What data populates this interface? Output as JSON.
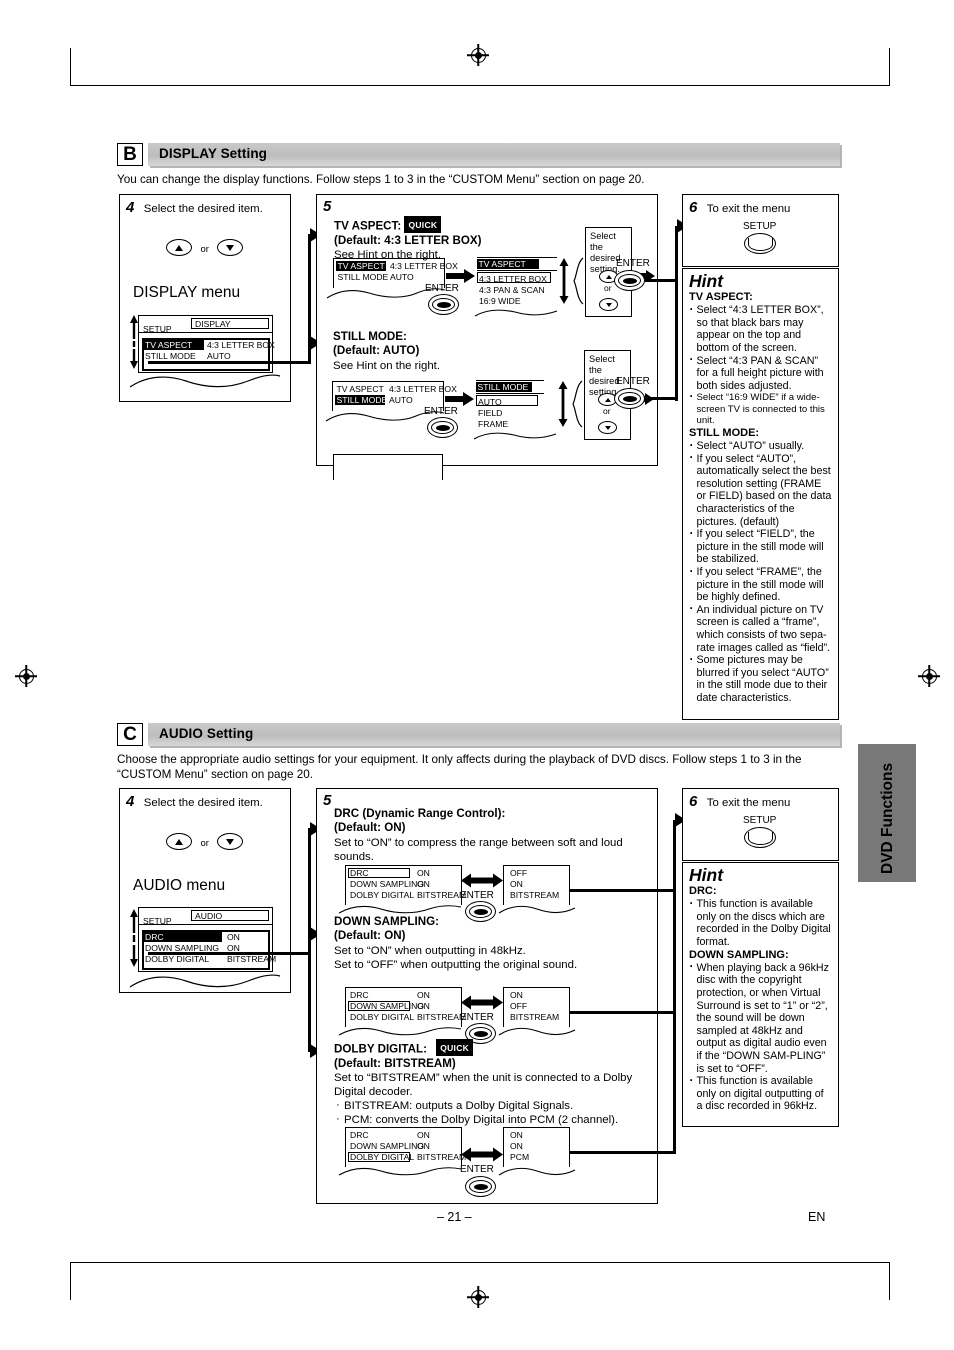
{
  "page": {
    "number": "– 21 –",
    "lang": "EN",
    "side_tab": "DVD Functions"
  },
  "display_section": {
    "letter": "B",
    "title": "DISPLAY Setting",
    "intro": "You can change the display functions. Follow steps 1 to 3 in the “CUSTOM Menu” section on page 20.",
    "step4": {
      "num": "4",
      "text": "Select the desired item.",
      "or_label": "or",
      "menu_title": "DISPLAY menu",
      "osd": {
        "header_left": "SETUP",
        "header_right": "DISPLAY",
        "rows": [
          {
            "name": "TV ASPECT",
            "value": "4:3 LETTER BOX"
          },
          {
            "name": "STILL MODE",
            "value": "AUTO"
          }
        ]
      }
    },
    "step5": {
      "num": "5",
      "items": [
        {
          "title": "TV ASPECT:",
          "badge": "QUICK",
          "default": "(Default: 4:3 LETTER BOX)",
          "note": "See Hint on the right.",
          "osd_left": {
            "rows": [
              {
                "name": "TV ASPECT",
                "value": "4:3 LETTER BOX"
              },
              {
                "name": "STILL MODE",
                "value": "AUTO"
              }
            ]
          },
          "enter_label": "ENTER",
          "osd_right": {
            "header": "TV ASPECT",
            "options": [
              "4:3 LETTER BOX",
              "4:3 PAN & SCAN",
              "16:9 WIDE"
            ]
          },
          "select_box": "Select the desired setting.",
          "or_label": "or",
          "enter2_label": "ENTER"
        },
        {
          "title": "STILL MODE:",
          "badge": "",
          "default": "(Default: AUTO)",
          "note": "See Hint on the right.",
          "osd_left": {
            "rows": [
              {
                "name": "TV ASPECT",
                "value": "4:3 LETTER BOX"
              },
              {
                "name": "STILL MODE",
                "value": "AUTO"
              }
            ]
          },
          "enter_label": "ENTER",
          "osd_right": {
            "header": "STILL MODE",
            "options": [
              "AUTO",
              "FIELD",
              "FRAME"
            ]
          },
          "select_box": "Select the desired setting.",
          "or_label": "or",
          "enter2_label": "ENTER"
        }
      ]
    },
    "step6": {
      "num": "6",
      "text": "To exit the menu",
      "button_label": "SETUP"
    },
    "hint": {
      "title": "Hint",
      "groups": [
        {
          "heading": "TV ASPECT:",
          "bullets": [
            "Select “4:3 LETTER BOX”, so that black bars may appear on the top and bottom of the screen.",
            "Select “4:3 PAN & SCAN” for a full height picture with both sides adjusted.",
            "Select “16:9 WIDE” if a wide-screen TV is connected to this unit."
          ]
        },
        {
          "heading": "STILL MODE:",
          "bullets": [
            "Select “AUTO” usually.",
            "If you select “AUTO”, automatically select the best resolution setting (FRAME or FIELD) based on the data characteristics of the pictures. (default)",
            "If you select “FIELD”, the picture in the still mode will be stabilized.",
            "If you select “FRAME”, the picture in the still mode will be highly defined.",
            "An individual picture on TV screen is called a “frame”, which consists of two sepa-rate images called as “field”.",
            "Some pictures may be blurred if you select “AUTO” in the still mode due to their date characteristics."
          ]
        }
      ]
    }
  },
  "audio_section": {
    "letter": "C",
    "title": "AUDIO Setting",
    "intro": "Choose the appropriate audio settings for your equipment. It only affects during the playback of DVD discs. Follow steps 1 to 3 in the “CUSTOM Menu” section on page 20.",
    "step4": {
      "num": "4",
      "text": "Select the desired item.",
      "or_label": "or",
      "menu_title": "AUDIO menu",
      "osd": {
        "header_left": "SETUP",
        "header_right": "AUDIO",
        "rows": [
          {
            "name": "DRC",
            "value": "ON"
          },
          {
            "name": "DOWN SAMPLING",
            "value": "ON"
          },
          {
            "name": "DOLBY DIGITAL",
            "value": "BITSTREAM"
          }
        ]
      }
    },
    "step5": {
      "num": "5",
      "items": [
        {
          "title": "DRC (Dynamic Range Control):",
          "badge": "",
          "default": "(Default: ON)",
          "lines": [
            "Set to “ON” to compress the range between soft and loud sounds."
          ],
          "bullets": [],
          "osd_left": {
            "rows": [
              {
                "name": "DRC",
                "value": "ON"
              },
              {
                "name": "DOWN SAMPLING",
                "value": "ON"
              },
              {
                "name": "DOLBY DIGITAL",
                "value": "BITSTREAM"
              }
            ],
            "selected": 0
          },
          "osd_right": {
            "values": [
              "OFF",
              "ON",
              "BITSTREAM"
            ]
          },
          "enter_label": "ENTER"
        },
        {
          "title": "DOWN SAMPLING:",
          "badge": "",
          "default": "(Default: ON)",
          "lines": [
            "Set to “ON” when outputting in 48kHz.",
            "Set to “OFF” when outputting the original sound."
          ],
          "bullets": [],
          "osd_left": {
            "rows": [
              {
                "name": "DRC",
                "value": "ON"
              },
              {
                "name": "DOWN SAMPLING",
                "value": "ON"
              },
              {
                "name": "DOLBY DIGITAL",
                "value": "BITSTREAM"
              }
            ],
            "selected": 1
          },
          "osd_right": {
            "values": [
              "ON",
              "OFF",
              "BITSTREAM"
            ]
          },
          "enter_label": "ENTER"
        },
        {
          "title": "DOLBY DIGITAL:",
          "badge": "QUICK",
          "default": "(Default: BITSTREAM)",
          "lines": [
            "Set to “BITSTREAM” when the unit is connected to a Dolby Digital decoder."
          ],
          "bullets": [
            "BITSTREAM: outputs a Dolby Digital Signals.",
            "PCM: converts the Dolby Digital into PCM (2 channel)."
          ],
          "osd_left": {
            "rows": [
              {
                "name": "DRC",
                "value": "ON"
              },
              {
                "name": "DOWN SAMPLING",
                "value": "ON"
              },
              {
                "name": "DOLBY DIGITAL",
                "value": "BITSTREAM"
              }
            ],
            "selected": 2
          },
          "osd_right": {
            "values": [
              "ON",
              "ON",
              "PCM"
            ]
          },
          "enter_label": "ENTER"
        }
      ]
    },
    "step6": {
      "num": "6",
      "text": "To exit the menu",
      "button_label": "SETUP"
    },
    "hint": {
      "title": "Hint",
      "groups": [
        {
          "heading": "DRC:",
          "bullets": [
            "This function is available only on the discs which are recorded in the Dolby Digital format."
          ]
        },
        {
          "heading": "DOWN SAMPLING:",
          "bullets": [
            "When playing back a 96kHz disc with the copyright protection, or when Virtual Surround is set to “1” or “2”, the sound will be down sampled at 48kHz and output as digital audio even if the “DOWN SAM-PLING” is set to “OFF”.",
            "This function is available only on digital outputting of a disc recorded in 96kHz."
          ]
        }
      ]
    }
  }
}
